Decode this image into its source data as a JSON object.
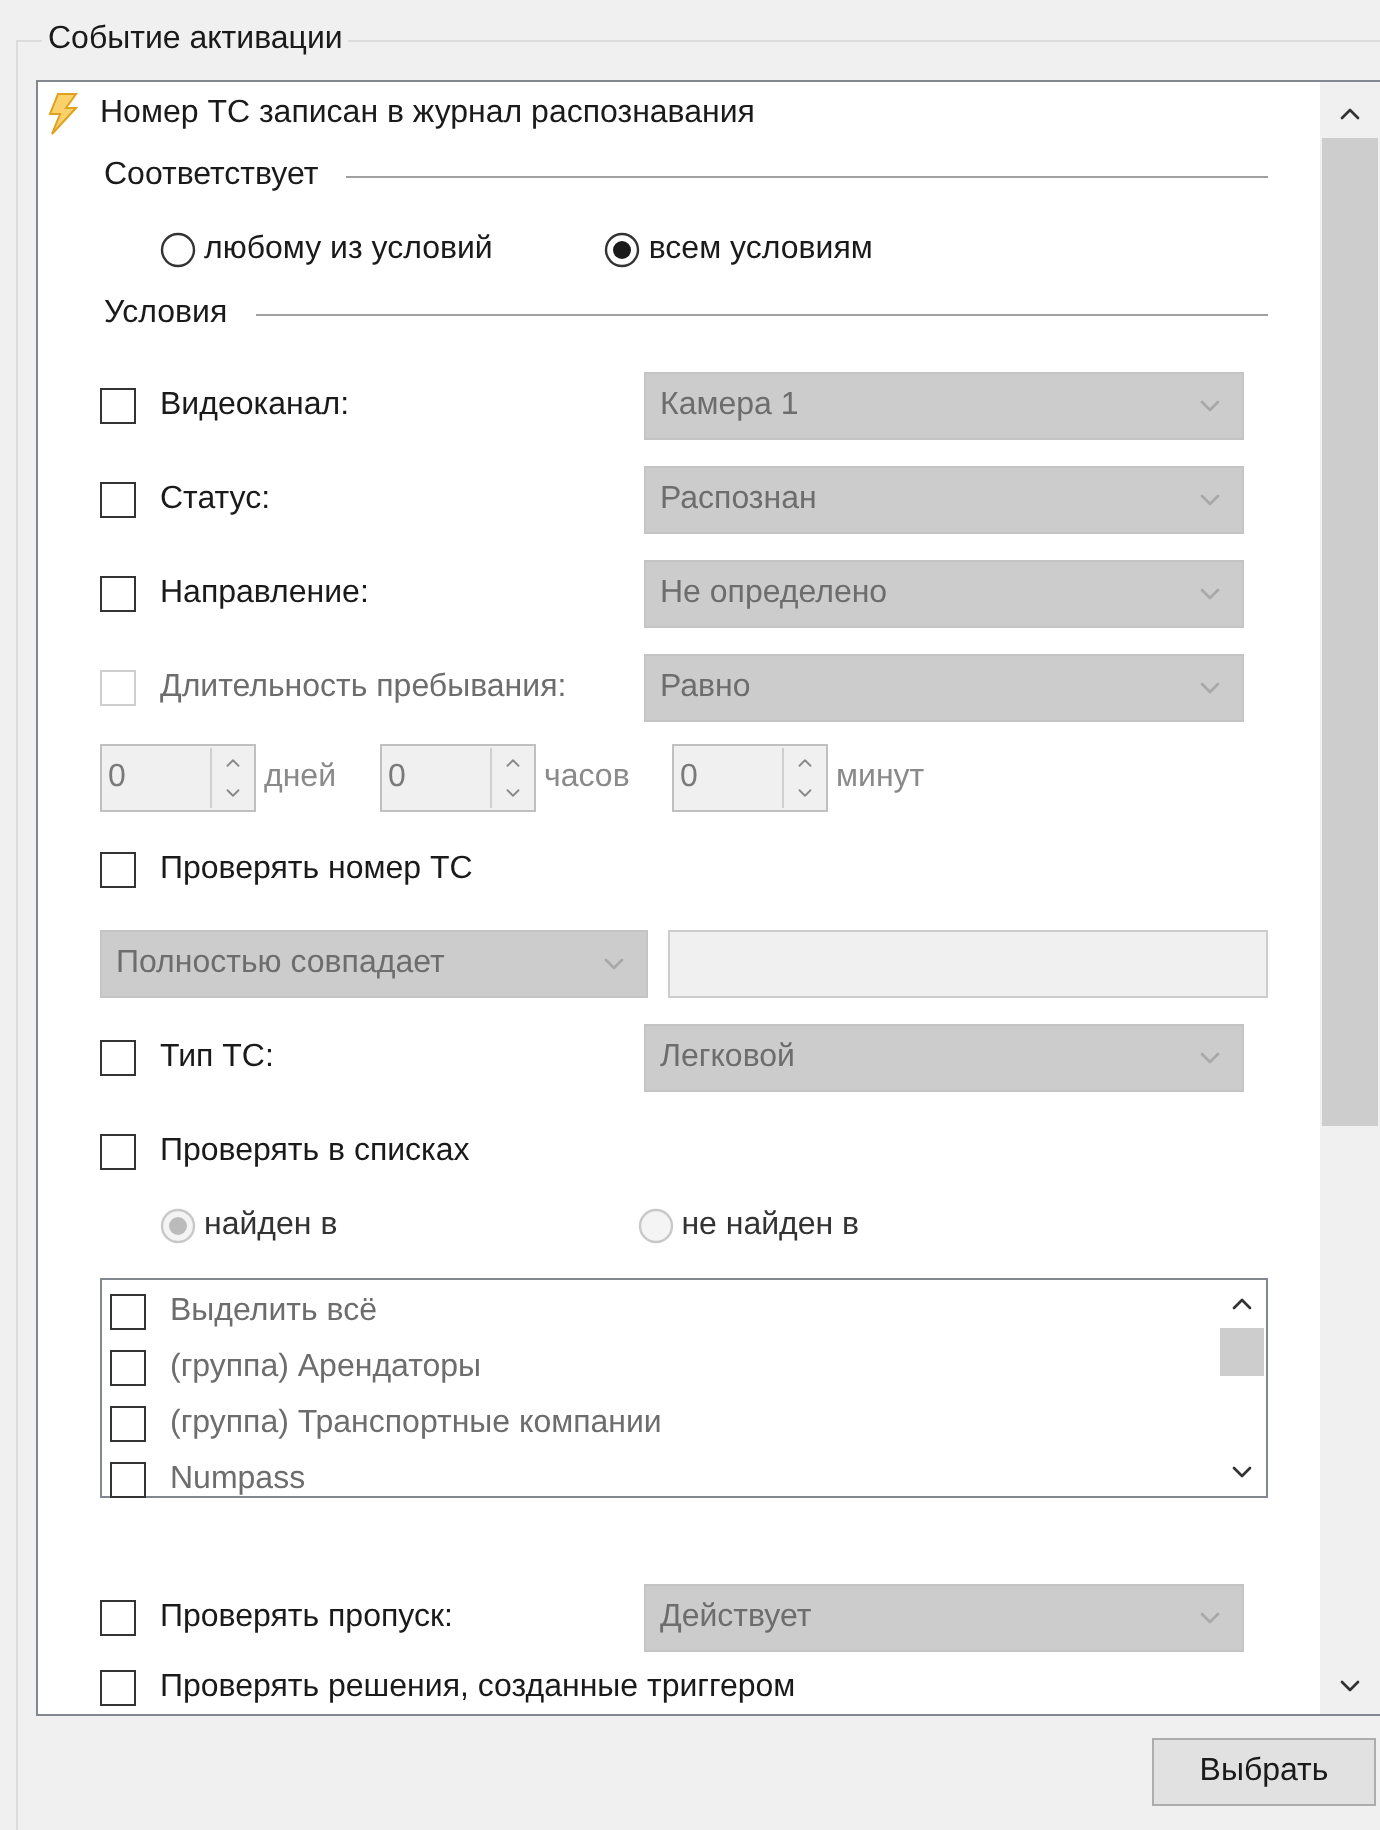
{
  "group_title": "Событие активации",
  "event_title": "Номер ТС записан в журнал распознавания",
  "match": {
    "label": "Соответствует",
    "options": [
      {
        "label": "любому из условий",
        "selected": false
      },
      {
        "label": "всем условиям",
        "selected": true
      }
    ]
  },
  "conditions_label": "Условия",
  "conditions": [
    {
      "kind": "select",
      "label": "Видеоканал:",
      "checked": false,
      "disabled": false,
      "value": "Камера 1"
    },
    {
      "kind": "select",
      "label": "Статус:",
      "checked": false,
      "disabled": false,
      "value": "Распознан"
    },
    {
      "kind": "select",
      "label": "Направление:",
      "checked": false,
      "disabled": false,
      "value": "Не определено"
    },
    {
      "kind": "select",
      "label": "Длительность пребывания:",
      "checked": false,
      "disabled": true,
      "value": "Равно"
    },
    {
      "kind": "spins",
      "spins": [
        {
          "value": "0",
          "unit": "дней"
        },
        {
          "value": "0",
          "unit": "часов"
        },
        {
          "value": "0",
          "unit": "минут"
        }
      ]
    },
    {
      "kind": "check",
      "label": "Проверять номер ТС",
      "checked": false,
      "disabled": false
    },
    {
      "kind": "match",
      "value": "Полностью совпадает"
    },
    {
      "kind": "select",
      "label": "Тип ТС:",
      "checked": false,
      "disabled": false,
      "value": "Легковой"
    },
    {
      "kind": "check",
      "label": "Проверять в списках",
      "checked": false,
      "disabled": false
    },
    {
      "kind": "radios",
      "disabled": true,
      "options": [
        {
          "label": "найден в",
          "selected": true
        },
        {
          "label": "не найден в",
          "selected": false
        }
      ]
    },
    {
      "kind": "list",
      "items": [
        {
          "label": "Выделить всё",
          "checked": false
        },
        {
          "label": "(группа) Арендаторы",
          "checked": false
        },
        {
          "label": "(группа) Транспортные компании",
          "checked": false
        },
        {
          "label": "Numpass",
          "checked": false
        }
      ]
    },
    {
      "kind": "select",
      "label": "Проверять пропуск:",
      "checked": false,
      "disabled": false,
      "value": "Действует"
    },
    {
      "kind": "check",
      "label": "Проверять решения, созданные триггером",
      "checked": false,
      "disabled": false
    }
  ],
  "button": "Выбрать"
}
